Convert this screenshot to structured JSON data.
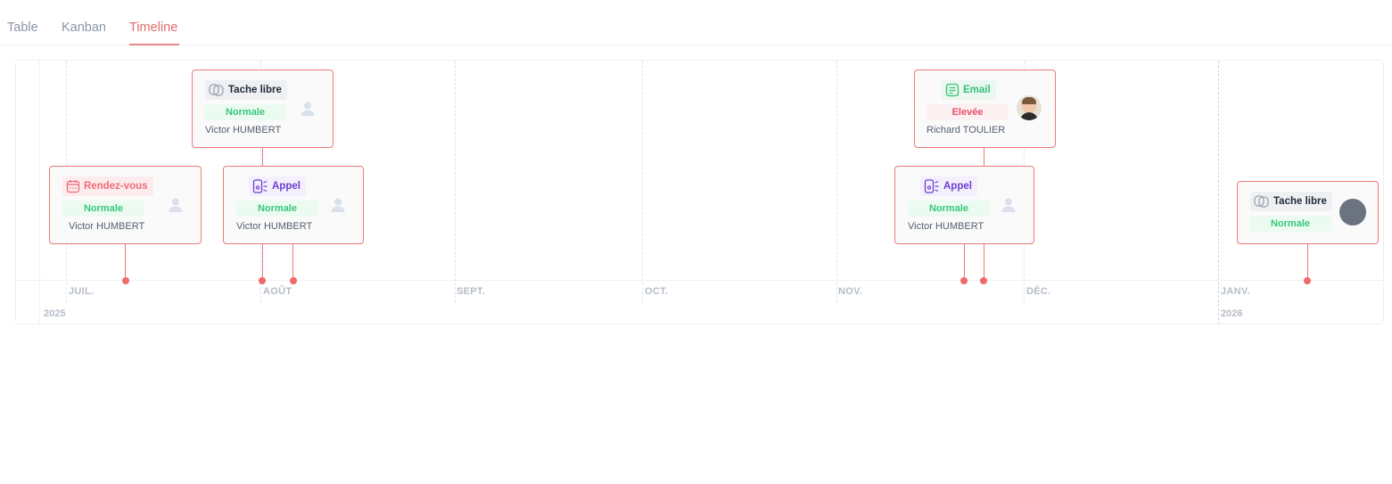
{
  "tabs": [
    {
      "label": "Table",
      "active": false
    },
    {
      "label": "Kanban",
      "active": false
    },
    {
      "label": "Timeline",
      "active": true
    }
  ],
  "timeline": {
    "months": [
      "JUIL.",
      "AOÛT",
      "SEPT.",
      "OCT.",
      "NOV.",
      "DÉC.",
      "JANV."
    ],
    "years": [
      "2025",
      "2026"
    ],
    "cards": [
      {
        "type": "Tache libre",
        "type_icon": "tache-icon",
        "priority": "Normale",
        "assignee": "Victor HUMBERT",
        "avatar": "user-placeholder-icon"
      },
      {
        "type": "Rendez-vous",
        "type_icon": "calendar-icon",
        "priority": "Normale",
        "assignee": "Victor HUMBERT",
        "avatar": "user-placeholder-icon"
      },
      {
        "type": "Appel",
        "type_icon": "phone-icon",
        "priority": "Normale",
        "assignee": "Victor HUMBERT",
        "avatar": "user-placeholder-icon"
      },
      {
        "type": "Email",
        "type_icon": "email-icon",
        "priority": "Elevée",
        "assignee": "Richard TOULIER",
        "avatar": "user-photo"
      },
      {
        "type": "Appel",
        "type_icon": "phone-icon",
        "priority": "Normale",
        "assignee": "Victor HUMBERT",
        "avatar": "user-placeholder-icon"
      },
      {
        "type": "Tache libre",
        "type_icon": "tache-icon",
        "priority": "Normale",
        "assignee": "",
        "avatar": "user-avatar-grey"
      }
    ]
  },
  "colors": {
    "accent": "#ea7a7a",
    "priority_normal": "#37c77b",
    "priority_high": "#e8506a",
    "appel": "#6d3fd0",
    "rdv": "#ef6b76",
    "email": "#34c17a"
  }
}
